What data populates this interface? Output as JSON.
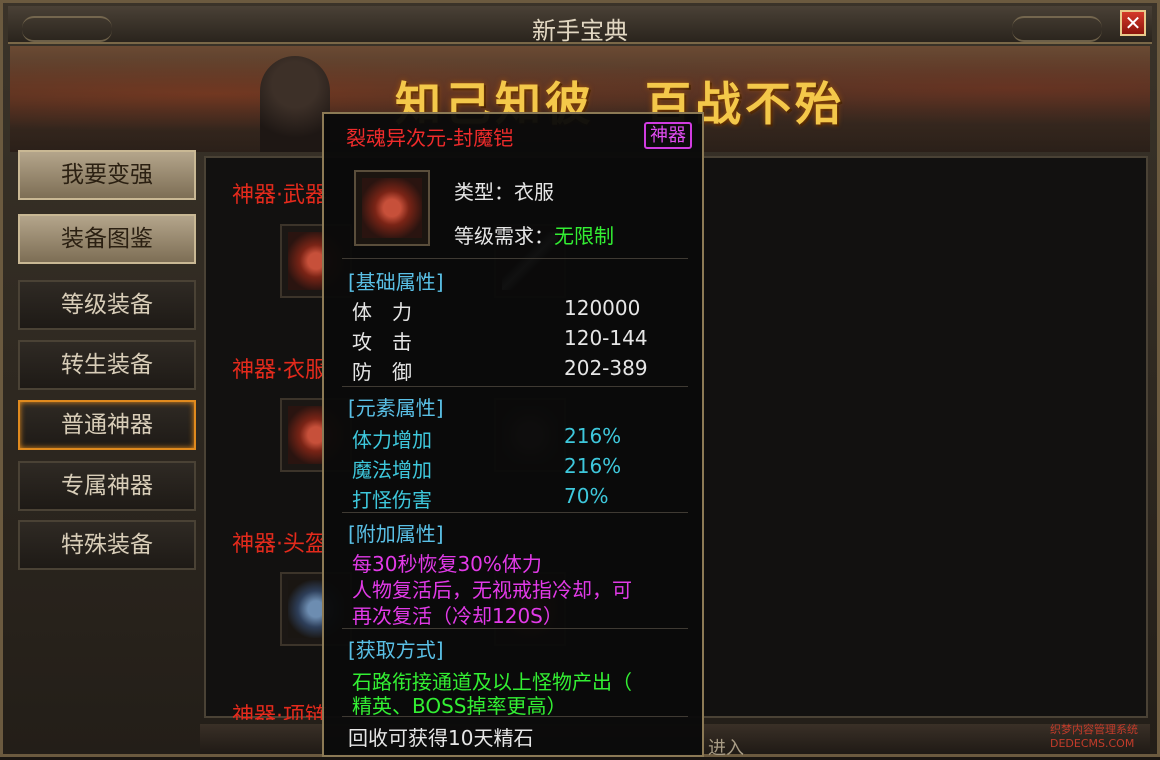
{
  "window": {
    "title": "新手宝典",
    "close_label": "✕"
  },
  "banner": {
    "slogan": "知己知彼　百战不殆"
  },
  "sidebar": {
    "items": [
      {
        "label": "我要变强"
      },
      {
        "label": "装备图鉴"
      },
      {
        "label": "等级装备"
      },
      {
        "label": "转生装备"
      },
      {
        "label": "普通神器"
      },
      {
        "label": "专属神器"
      },
      {
        "label": "特殊装备"
      }
    ]
  },
  "categories": [
    {
      "label": "神器·武器"
    },
    {
      "label": "神器·衣服"
    },
    {
      "label": "神器·头盔"
    },
    {
      "label": "神器·项链"
    }
  ],
  "tooltip": {
    "name": "裂魂异次元-封魔铠",
    "badge": "神器",
    "type_label": "类型：",
    "type_value": "衣服",
    "level_label": "等级需求：",
    "level_value": "无限制",
    "base_title": "[基础属性]",
    "base_stats": [
      {
        "name": "体　力",
        "value": "120000"
      },
      {
        "name": "攻　击",
        "value": "120-144"
      },
      {
        "name": "防　御",
        "value": "202-389"
      }
    ],
    "element_title": "[元素属性]",
    "element_stats": [
      {
        "name": "体力增加",
        "value": "216%"
      },
      {
        "name": "魔法增加",
        "value": "216%"
      },
      {
        "name": "打怪伤害",
        "value": "70%"
      }
    ],
    "extra_title": "[附加属性]",
    "extra_lines": [
      "每30秒恢复30%体力",
      "人物复活后，无视戒指冷却，可",
      "再次复活（冷却120S）"
    ],
    "source_title": "[获取方式]",
    "source_lines": [
      "石路衔接通道及以上怪物产出（",
      "精英、BOSS掉率更高）"
    ],
    "recycle": "回收可获得10天精石"
  },
  "footer": {
    "enter": "进入"
  },
  "watermark": {
    "line1": "织梦内容管理系统",
    "line2": "DEDECMS.COM"
  }
}
